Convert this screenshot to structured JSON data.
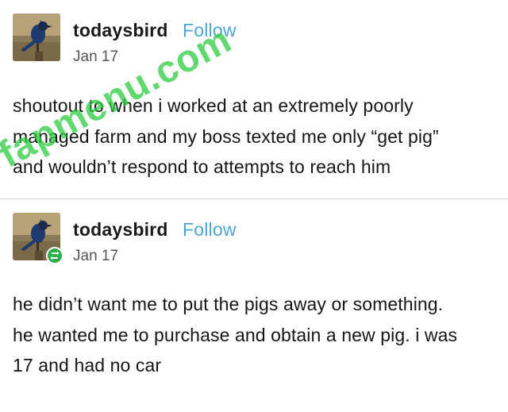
{
  "posts": [
    {
      "username": "todaysbird",
      "follow_label": "Follow",
      "date": "Jan 17",
      "avatar_icon": "bird-avatar-icon",
      "lines": [
        "shoutout to when i worked at an extremely poorly",
        "managed farm and my boss texted me only “get pig”",
        "and wouldn’t respond to attempts to reach him"
      ]
    },
    {
      "username": "todaysbird",
      "follow_label": "Follow",
      "date": "Jan 17",
      "avatar_icon": "bird-avatar-icon",
      "badge_icon": "reblog-icon",
      "lines": [
        "he didn’t want me to put the pigs away or something.",
        "he wanted me to purchase and obtain a new pig. i was",
        "17 and had no car"
      ]
    }
  ],
  "watermark": {
    "text": "fapmenu.com",
    "color": "#2ecc40"
  },
  "colors": {
    "follow": "#4fa4d4",
    "reblog_badge": "#2ead4b",
    "divider": "#d9d9d9"
  }
}
